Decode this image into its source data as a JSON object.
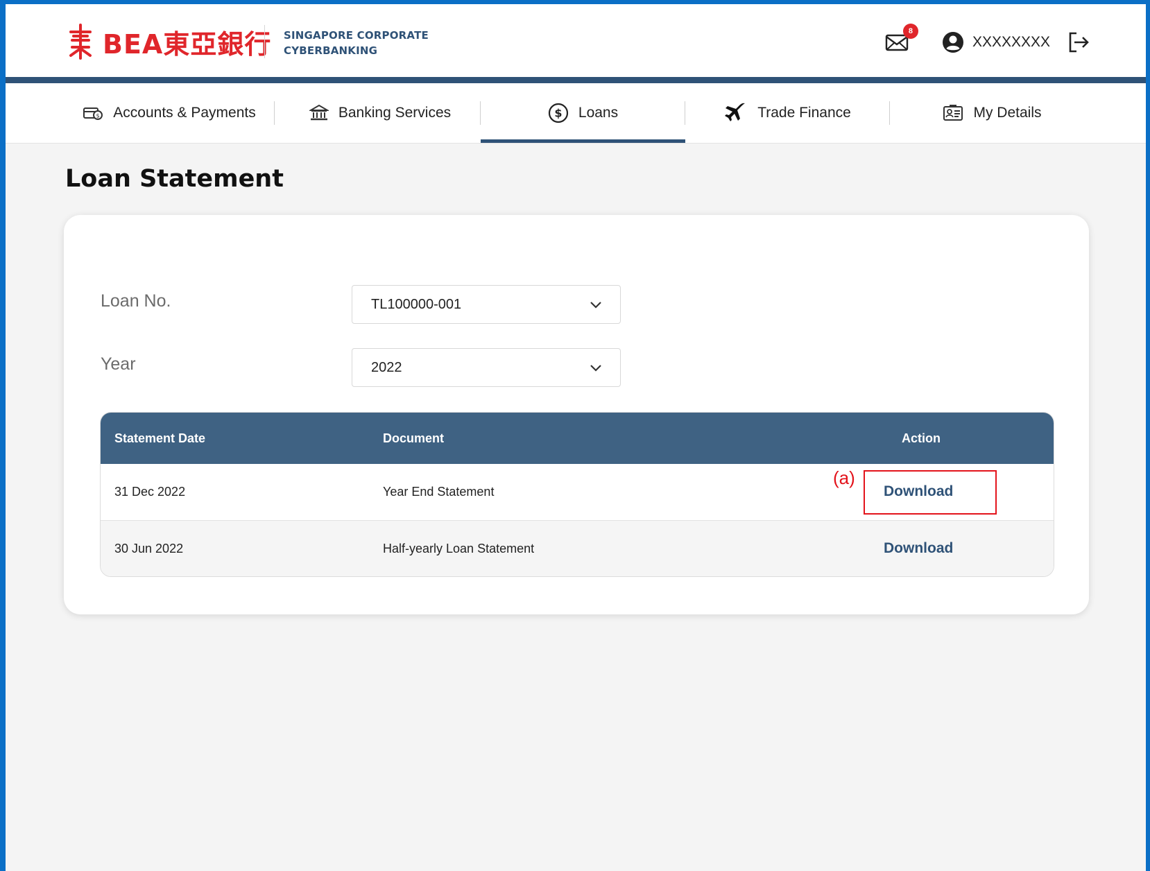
{
  "header": {
    "brand": "BEA東亞銀行",
    "subtitle_line1": "SINGAPORE CORPORATE",
    "subtitle_line2": "CYBERBANKING",
    "mail_badge": "8",
    "username": "XXXXXXXX"
  },
  "nav": {
    "items": [
      {
        "label": "Accounts & Payments",
        "icon": "wallet-icon"
      },
      {
        "label": "Banking Services",
        "icon": "bank-icon"
      },
      {
        "label": "Loans",
        "icon": "dollar-coin-icon",
        "active": true
      },
      {
        "label": "Trade Finance",
        "icon": "airplane-icon"
      },
      {
        "label": "My Details",
        "icon": "id-card-icon"
      }
    ]
  },
  "page": {
    "title": "Loan Statement"
  },
  "form": {
    "loan_no_label": "Loan No.",
    "loan_no_value": "TL100000-001",
    "year_label": "Year",
    "year_value": "2022"
  },
  "table": {
    "headers": [
      "Statement Date",
      "Document",
      "Action"
    ],
    "rows": [
      {
        "date": "31 Dec 2022",
        "document": "Year End Statement",
        "action": "Download"
      },
      {
        "date": "30 Jun 2022",
        "document": "Half-yearly Loan Statement",
        "action": "Download"
      }
    ]
  },
  "annotation": {
    "label": "(a)"
  },
  "colors": {
    "brand_red": "#e0262b",
    "navy": "#2f5277",
    "table_header": "#3f6283",
    "highlight_red": "#e3131b"
  }
}
